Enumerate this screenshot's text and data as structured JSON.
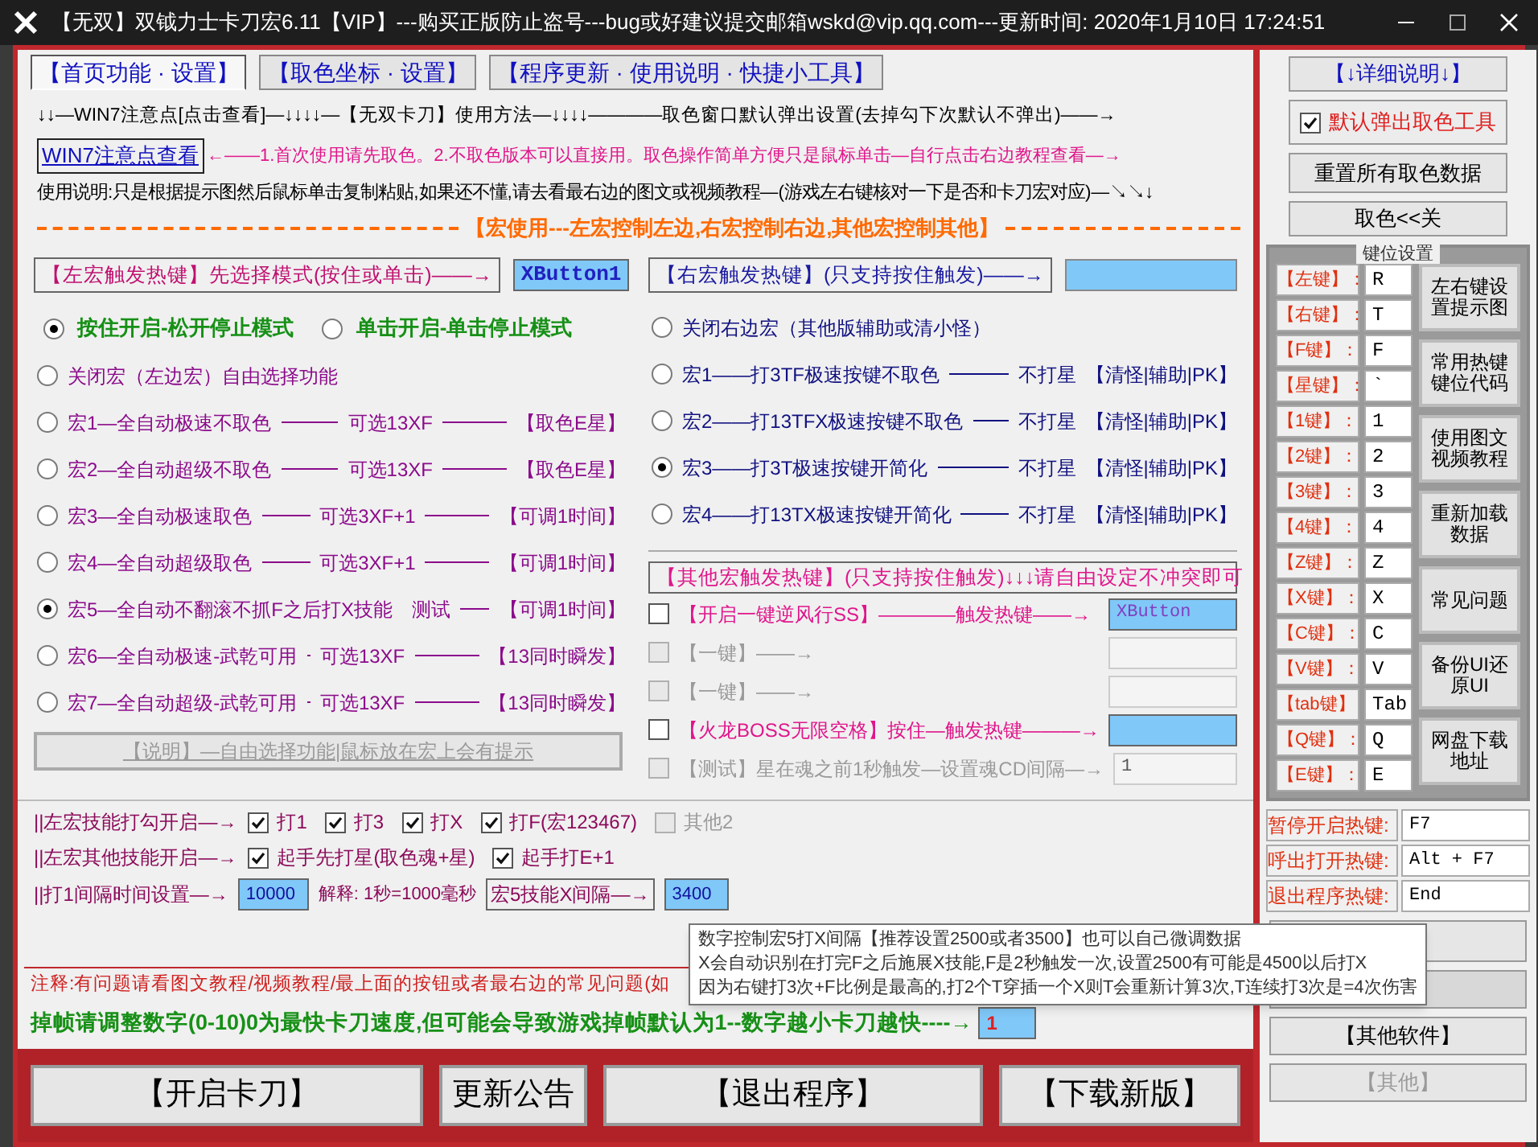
{
  "window": {
    "title": "【无双】双钺力士卡刀宏6.11【VIP】---购买正版防止盗号---bug或好建议提交邮箱wskd@vip.qq.com---更新时间: 2020年1月10日 17:24:51"
  },
  "tabs": [
    {
      "label": "【首页功能 · 设置】",
      "selected": true
    },
    {
      "label": "【取色坐标 · 设置】",
      "selected": false
    },
    {
      "label": "【程序更新 · 使用说明 · 快捷小工具】",
      "selected": false
    }
  ],
  "header": {
    "guide_line": "↓↓—WIN7注意点[点击查看]—↓↓↓↓—【无双卡刀】使用方法—↓↓↓↓————取色窗口默认弹出设置(去掉勾下次默认不弹出)——→",
    "win7_link": "WIN7注意点查看",
    "hint": "←——1.首次使用请先取色。2.不取色版本可以直接用。取色操作简单方便只是鼠标单击—自行点击右边教程查看—→",
    "usage": "使用说明:只是根据提示图然后鼠标单击复制粘贴,如果还不懂,请去看最右边的图文或视频教程—(游戏左右键核对一下是否和卡刀宏对应)—↘↘↓"
  },
  "section_title": "【宏使用---左宏控制左边,右宏控制右边,其他宏控制其他】",
  "left_macro": {
    "hotkey_label": "【左宏触发热键】先选择模式(按住或单击)——→",
    "hotkey_value": "XButton1",
    "modes": [
      {
        "label": "按住开启-松开停止模式",
        "selected": true
      },
      {
        "label": "单击开启-单击停止模式",
        "selected": false
      }
    ],
    "options": [
      {
        "label": "关闭宏（左边宏）自由选择功能",
        "selected": false
      },
      {
        "label": "宏1—全自动极速不取色",
        "note": "可选13XF",
        "tag": "【取色E星】",
        "selected": false
      },
      {
        "label": "宏2—全自动超级不取色",
        "note": "可选13XF",
        "tag": "【取色E星】",
        "selected": false
      },
      {
        "label": "宏3—全自动极速取色",
        "note": "可选3XF+1",
        "tag": "【可调1时间】",
        "selected": false
      },
      {
        "label": "宏4—全自动超级取色",
        "note": "可选3XF+1",
        "tag": "【可调1时间】",
        "selected": false
      },
      {
        "label": "宏5—全自动不翻滚不抓F之后打X技能",
        "note": "测试",
        "tag": "【可调1时间】",
        "selected": true
      },
      {
        "label": "宏6—全自动极速-武乾可用",
        "note": "可选13XF",
        "tag": "【13同时瞬发】",
        "selected": false
      },
      {
        "label": "宏7—全自动超级-武乾可用",
        "note": "可选13XF",
        "tag": "【13同时瞬发】",
        "selected": false
      }
    ],
    "info_button": "【说明】—自由选择功能|鼠标放在宏上会有提示"
  },
  "right_macro": {
    "hotkey_label": "【右宏触发热键】(只支持按住触发)——→",
    "options": [
      {
        "label": "关闭右边宏（其他版辅助或清小怪）",
        "selected": false
      },
      {
        "label": "宏1——打3TF极速按键不取色",
        "note": "不打星",
        "tag": "【清怪|辅助|PK】",
        "selected": false
      },
      {
        "label": "宏2——打13TFX极速按键不取色",
        "note": "不打星",
        "tag": "【清怪|辅助|PK】",
        "selected": false
      },
      {
        "label": "宏3——打3T极速按键开简化",
        "note": "不打星",
        "tag": "【清怪|辅助|PK】",
        "selected": true
      },
      {
        "label": "宏4——打13TX极速按键开简化",
        "note": "不打星",
        "tag": "【清怪|辅助|PK】",
        "selected": false
      }
    ]
  },
  "other_macro": {
    "header": "【其他宏触发热键】(只支持按住触发)↓↓↓请自由设定不冲突即可",
    "items": [
      {
        "label": "【开启一键逆风行SS】————触发热键——→",
        "checked": false,
        "disabled": false,
        "value": "XButton",
        "filled": true
      },
      {
        "label": "【一键】——→",
        "checked": false,
        "disabled": true,
        "filled": false
      },
      {
        "label": "【一键】——→",
        "checked": false,
        "disabled": true,
        "filled": false
      },
      {
        "label": "【火龙BOSS无限空格】按住—触发热键———→",
        "checked": false,
        "disabled": false,
        "filled": true
      },
      {
        "label": "【测试】星在魂之前1秒触发—设置魂CD间隔—→",
        "checked": false,
        "disabled": true,
        "value": "1",
        "filled": false
      }
    ]
  },
  "skills": [
    {
      "label": "||左宏技能打勾开启—→",
      "options": [
        {
          "label": "打1",
          "checked": true,
          "disabled": false
        },
        {
          "label": "打3",
          "checked": true,
          "disabled": false
        },
        {
          "label": "打X",
          "checked": true,
          "disabled": false
        },
        {
          "label": "打F(宏123467)",
          "checked": true,
          "disabled": false
        },
        {
          "label": "其他2",
          "checked": false,
          "disabled": true
        }
      ]
    },
    {
      "label": "||左宏其他技能开启—→",
      "options": [
        {
          "label": "起手先打星(取色魂+星)",
          "checked": true,
          "disabled": false
        },
        {
          "label": "起手打E+1",
          "checked": true,
          "disabled": false
        }
      ]
    }
  ],
  "interval": {
    "label": "||打1间隔时间设置—→",
    "value": "10000",
    "explain": "解释: 1秒=1000毫秒",
    "x_label": "宏5技能X间隔—→",
    "x_value": "3400"
  },
  "tooltip": [
    "数字控制宏5打X间隔【推荐设置2500或者3500】也可以自己微调数据",
    "X会自动识别在打完F之后施展X技能,F是2秒触发一次,设置2500有可能是4500以后打X",
    "因为右键打3次+F比例是最高的,打2个T穿插一个X则T会重新计算3次,T连续打3次是=4次伤害"
  ],
  "note": "注释:有问题请看图文教程/视频教程/最上面的按钮或者最右边的常见问题(如",
  "frame_drop": {
    "label": "掉帧请调整数字(0-10)0为最快卡刀速度,但可能会导致游戏掉帧默认为1--数字越小卡刀越快----→",
    "value": "1"
  },
  "bottom_buttons": [
    "【开启卡刀】",
    "更新公告",
    "【退出程序】",
    "【下载新版】"
  ],
  "sidebar": {
    "help_button": "【↓详细说明↓】",
    "popup_checkbox": {
      "label": "默认弹出取色工具",
      "checked": true
    },
    "reset_button": "重置所有取色数据",
    "close_button": "取色<<关",
    "key_panel_title": "键位设置",
    "keys": [
      {
        "label": "【左键】：",
        "value": "R"
      },
      {
        "label": "【右键】：",
        "value": "T"
      },
      {
        "label": "【F键】：",
        "value": "F"
      },
      {
        "label": "【星键】：",
        "value": "`"
      },
      {
        "label": "【1键】：",
        "value": "1"
      },
      {
        "label": "【2键】：",
        "value": "2"
      },
      {
        "label": "【3键】：",
        "value": "3"
      },
      {
        "label": "【4键】：",
        "value": "4"
      },
      {
        "label": "【Z键】：",
        "value": "Z"
      },
      {
        "label": "【X键】：",
        "value": "X"
      },
      {
        "label": "【C键】：",
        "value": "C"
      },
      {
        "label": "【V键】：",
        "value": "V"
      },
      {
        "label": "【tab键】",
        "value": "Tab"
      },
      {
        "label": "【Q键】：",
        "value": "Q"
      },
      {
        "label": "【E键】：",
        "value": "E"
      }
    ],
    "key_buttons": [
      "左右键设置提示图",
      "常用热键键位代码",
      "使用图文视频教程",
      "重新加载数据",
      "常见问题",
      "备份UI还原UI",
      "网盘下载地址"
    ],
    "hotkeys": [
      {
        "label": "暂停开启热键:",
        "value": "F7"
      },
      {
        "label": "呼出打开热键:",
        "value": "Alt + F7"
      },
      {
        "label": "退出程序热键:",
        "value": "End"
      }
    ],
    "buttons": [
      {
        "label": "【其他软件】",
        "disabled": false
      },
      {
        "label": "【其他】",
        "disabled": true
      }
    ]
  }
}
